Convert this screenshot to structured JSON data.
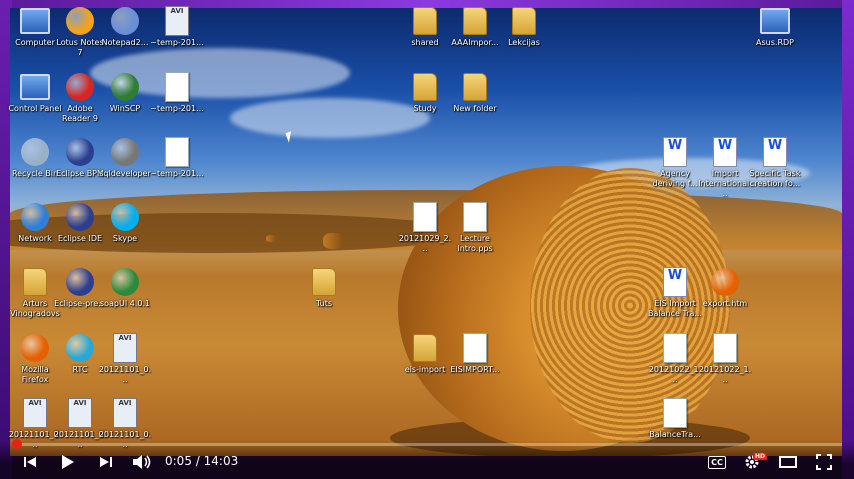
{
  "desktop": {
    "icons": [
      {
        "label": "Computer",
        "type": "pc",
        "color": "#3a7bd5"
      },
      {
        "label": "Lotus Notes 7",
        "type": "round",
        "color": "#f2a31b"
      },
      {
        "label": "Notepad2...",
        "type": "round",
        "color": "#6b8fd6"
      },
      {
        "label": "~temp-201...",
        "type": "avi",
        "color": "#334455"
      },
      {
        "label": "shared",
        "type": "folder",
        "color": "#d6a437"
      },
      {
        "label": "AAAImpor...",
        "type": "folder",
        "color": "#d6a437"
      },
      {
        "label": "Lekcijas",
        "type": "folder",
        "color": "#d6a437"
      },
      {
        "label": "Asus.RDP",
        "type": "pc",
        "color": "#3a7bd5"
      },
      {
        "label": "Control Panel",
        "type": "pc",
        "color": "#3fa9f5"
      },
      {
        "label": "Adobe Reader 9",
        "type": "round",
        "color": "#d7261e"
      },
      {
        "label": "WinSCP",
        "type": "round",
        "color": "#2e7d32"
      },
      {
        "label": "~temp-201...",
        "type": "doc",
        "color": "#ffffff"
      },
      {
        "label": "Study",
        "type": "folder",
        "color": "#d6a437"
      },
      {
        "label": "New folder",
        "type": "folder",
        "color": "#d6a437"
      },
      {
        "label": "Recycle Bin",
        "type": "round",
        "color": "#9ab0c8"
      },
      {
        "label": "Eclipse BPM",
        "type": "round",
        "color": "#2c3e8f"
      },
      {
        "label": "sqldeveloper",
        "type": "round",
        "color": "#777777"
      },
      {
        "label": "~temp-201...",
        "type": "doc",
        "color": "#ffffff"
      },
      {
        "label": "Agency deriving f...",
        "type": "word",
        "color": "#1d4ed8"
      },
      {
        "label": "Import International...",
        "type": "word",
        "color": "#1d4ed8"
      },
      {
        "label": "Specific Task creation fo...",
        "type": "word",
        "color": "#1d4ed8"
      },
      {
        "label": "Network",
        "type": "round",
        "color": "#2f7fd8"
      },
      {
        "label": "Eclipse IDE",
        "type": "round",
        "color": "#2c3e8f"
      },
      {
        "label": "Skype",
        "type": "round",
        "color": "#00aff0"
      },
      {
        "label": "20121029_2...",
        "type": "doc",
        "color": "#ffffff"
      },
      {
        "label": "Lecture Intro.pps",
        "type": "doc",
        "color": "#ffffff"
      },
      {
        "label": "Arturs Vinogradovs",
        "type": "folder",
        "color": "#d6a437"
      },
      {
        "label": "Eclipse-pre...",
        "type": "round",
        "color": "#2c3e8f"
      },
      {
        "label": "soapUI 4.0.1",
        "type": "round",
        "color": "#2b8a3e"
      },
      {
        "label": "Tuts",
        "type": "folder",
        "color": "#d6a437"
      },
      {
        "label": "EIS Import Balance Tra...",
        "type": "word",
        "color": "#1d4ed8"
      },
      {
        "label": "export.htm",
        "type": "round",
        "color": "#e66000"
      },
      {
        "label": "Mozilla Firefox",
        "type": "round",
        "color": "#e66000"
      },
      {
        "label": "RTC",
        "type": "round",
        "color": "#2aa7d6"
      },
      {
        "label": "20121101_0...",
        "type": "avi",
        "color": "#334455"
      },
      {
        "label": "eis-import",
        "type": "folder",
        "color": "#d6a437"
      },
      {
        "label": "EISIMPORT...",
        "type": "doc",
        "color": "#ffffff"
      },
      {
        "label": "20121022_1...",
        "type": "doc",
        "color": "#ffffff"
      },
      {
        "label": "20121022_1...",
        "type": "doc",
        "color": "#ffffff"
      },
      {
        "label": "20121101_0...",
        "type": "avi",
        "color": "#334455"
      },
      {
        "label": "20121101_0...",
        "type": "avi",
        "color": "#334455"
      },
      {
        "label": "20121101_0...",
        "type": "avi",
        "color": "#334455"
      },
      {
        "label": "BalanceTra...",
        "type": "doc",
        "color": "#ffffff"
      }
    ]
  },
  "player": {
    "time_current": "0:05",
    "time_separator": "/",
    "time_total": "14:03",
    "progress_fraction": 0.006,
    "cc_label": "CC",
    "hd_label": "HD",
    "accent": "#e62117"
  }
}
